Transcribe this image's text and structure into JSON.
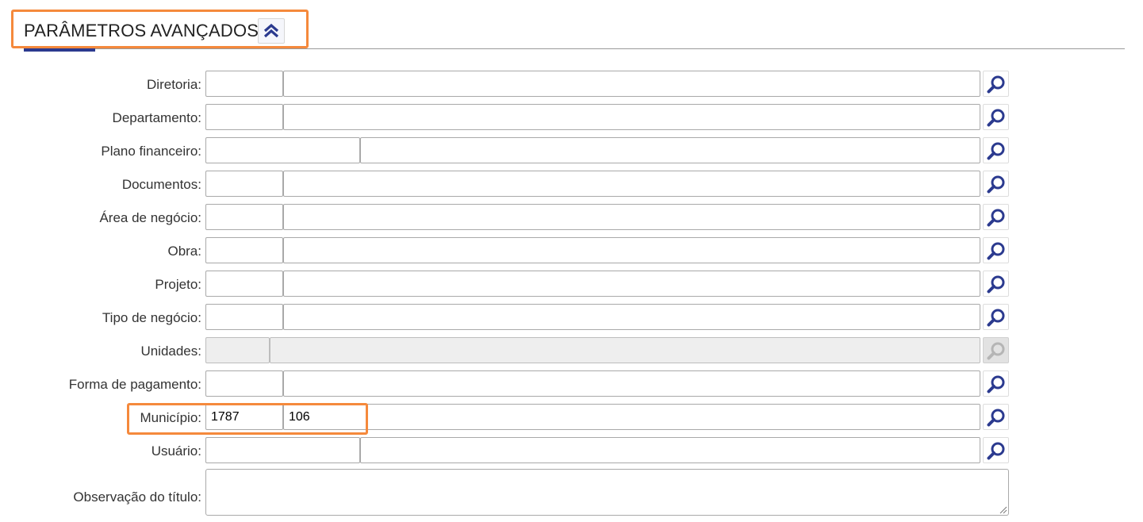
{
  "section": {
    "title": "PARÂMETROS AVANÇADOS",
    "collapse_icon": "chevron-double-up-icon"
  },
  "colors": {
    "accent": "#2b3a8f",
    "highlight": "#f5893c",
    "search_icon": "#2b3a8f"
  },
  "fields": [
    {
      "label": "Diretoria:",
      "code": "",
      "description": ""
    },
    {
      "label": "Departamento:",
      "code": "",
      "description": ""
    },
    {
      "label": "Plano financeiro:",
      "code": "",
      "description": ""
    },
    {
      "label": "Documentos:",
      "code": "",
      "description": ""
    },
    {
      "label": "Área de negócio:",
      "code": "",
      "description": ""
    },
    {
      "label": "Obra:",
      "code": "",
      "description": ""
    },
    {
      "label": "Projeto:",
      "code": "",
      "description": ""
    },
    {
      "label": "Tipo de negócio:",
      "code": "",
      "description": ""
    },
    {
      "label": "Unidades:",
      "code": "",
      "description": "",
      "disabled": true
    },
    {
      "label": "Forma de pagamento:",
      "code": "",
      "description": ""
    },
    {
      "label": "Município:",
      "code": "1787",
      "description": "106"
    },
    {
      "label": "Usuário:",
      "code": "",
      "description": ""
    }
  ],
  "observacao": {
    "label": "Observação do título:",
    "value": ""
  },
  "lookup_icon": "search-icon"
}
